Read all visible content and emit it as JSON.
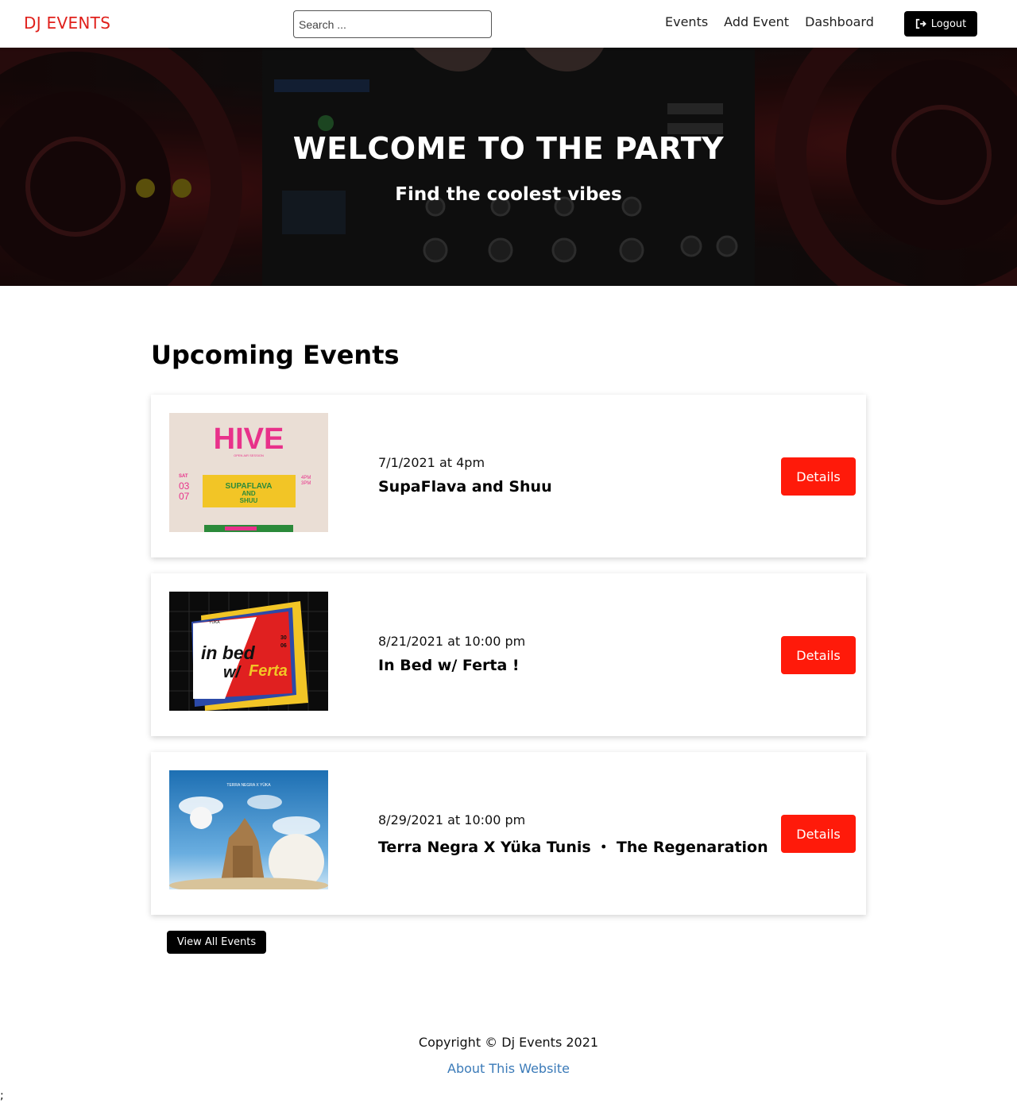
{
  "header": {
    "logo": "DJ EVENTS",
    "search_placeholder": "Search ...",
    "nav": [
      "Events",
      "Add Event",
      "Dashboard"
    ],
    "logout_label": "Logout",
    "logout_icon": "sign-out-icon"
  },
  "hero": {
    "title": "WELCOME TO THE PARTY",
    "subtitle": "Find the coolest vibes"
  },
  "main": {
    "title": "Upcoming Events",
    "events": [
      {
        "date": "7/1/2021 at 4pm",
        "name": "SupaFlava and Shuu",
        "button": "Details"
      },
      {
        "date": "8/21/2021 at 10:00 pm",
        "name": "In Bed w/ Ferta !",
        "button": "Details"
      },
      {
        "date": "8/29/2021 at 10:00 pm",
        "name": "Terra Negra X Yüka Tunis ・ The Regenaration",
        "button": "Details"
      }
    ],
    "view_all": "View All Events"
  },
  "posters": {
    "hive": {
      "title": "HIVE",
      "subtitle": "OPEN AIR SESSION",
      "day": "SAT",
      "date_top": "03",
      "date_bottom": "07",
      "time_top": "4PM",
      "time_bottom": "3PM",
      "act_line1": "SUPAFLAVA",
      "act_line2": "AND",
      "act_line3": "SHUU"
    },
    "inbed": {
      "brand": "YÜKA",
      "line1": "in bed",
      "line2": "w/",
      "line3": "Ferta",
      "date_top": "30",
      "date_bottom": "06"
    },
    "terra": {
      "brand": "TERRA NEGRA X YÜKA"
    }
  },
  "footer": {
    "copyright": "Copyright © Dj Events 2021",
    "about_link": "About This Website",
    "stray": ";"
  },
  "colors": {
    "brand": "#e0201b",
    "details_button": "#ff1a0a",
    "link": "#3a7ab8"
  }
}
